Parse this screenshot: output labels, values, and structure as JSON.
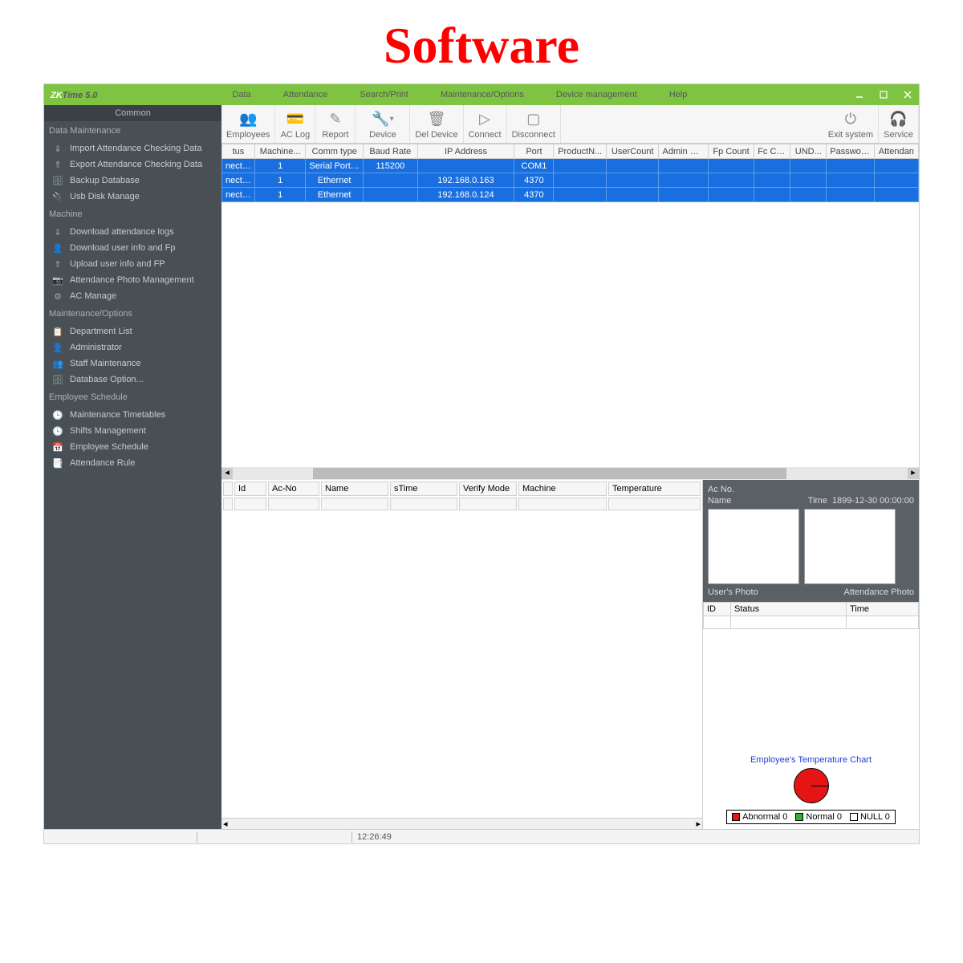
{
  "page_heading": "Software",
  "app": {
    "title_green": "ZK",
    "title_gray": "Time 5.0"
  },
  "menu": [
    "Data",
    "Attendance",
    "Search/Print",
    "Maintenance/Options",
    "Device management",
    "Help"
  ],
  "toolbar": {
    "items": [
      {
        "label": "Employees"
      },
      {
        "label": "AC Log"
      },
      {
        "label": "Report"
      },
      {
        "label": "Device"
      },
      {
        "label": "Del Device"
      },
      {
        "label": "Connect"
      },
      {
        "label": "Disconnect"
      }
    ],
    "right": [
      {
        "label": "Exit system"
      },
      {
        "label": "Service"
      }
    ]
  },
  "sidebar": {
    "header": "Common",
    "sections": [
      {
        "title": "Data Maintenance",
        "items": [
          "Import Attendance Checking Data",
          "Export Attendance Checking Data",
          "Backup Database",
          "Usb Disk Manage"
        ]
      },
      {
        "title": "Machine",
        "items": [
          "Download attendance logs",
          "Download user info and Fp",
          "Upload user info and FP",
          "Attendance Photo Management",
          "AC Manage"
        ]
      },
      {
        "title": "Maintenance/Options",
        "items": [
          "Department List",
          "Administrator",
          "Staff Maintenance",
          "Database Option..."
        ]
      },
      {
        "title": "Employee Schedule",
        "items": [
          "Maintenance Timetables",
          "Shifts Management",
          "Employee Schedule",
          "Attendance Rule"
        ]
      }
    ]
  },
  "device_grid": {
    "columns": [
      "tus",
      "Machine...",
      "Comm type",
      "Baud Rate",
      "IP Address",
      "Port",
      "ProductN...",
      "UserCount",
      "Admin Co...",
      "Fp Count",
      "Fc Co...",
      "UND...",
      "Password...",
      "Attendan"
    ],
    "rows": [
      {
        "c": [
          "nected",
          "1",
          "Serial Port/...",
          "115200",
          "",
          "COM1",
          "",
          "",
          "",
          "",
          "",
          "",
          "",
          ""
        ]
      },
      {
        "c": [
          "nected",
          "1",
          "Ethernet",
          "",
          "192.168.0.163",
          "4370",
          "",
          "",
          "",
          "",
          "",
          "",
          "",
          ""
        ]
      },
      {
        "c": [
          "nected",
          "1",
          "Ethernet",
          "",
          "192.168.0.124",
          "4370",
          "",
          "",
          "",
          "",
          "",
          "",
          "",
          ""
        ]
      }
    ]
  },
  "log_grid": {
    "columns": [
      "Id",
      "Ac-No",
      "Name",
      "sTime",
      "Verify Mode",
      "Machine",
      "Temperature"
    ]
  },
  "info_panel": {
    "acno_label": "Ac No.",
    "name_label": "Name",
    "time_label": "Time",
    "time_value": "1899-12-30 00:00:00",
    "user_photo": "User's Photo",
    "att_photo": "Attendance Photo"
  },
  "status_grid": {
    "columns": [
      "ID",
      "Status",
      "Time"
    ]
  },
  "chart": {
    "title": "Employee's Temperature Chart",
    "legend": [
      {
        "label": "Abnormal 0",
        "color": "#e51515"
      },
      {
        "label": "Normal 0",
        "color": "#2db02d"
      },
      {
        "label": "NULL 0",
        "color": "#ffffff"
      }
    ]
  },
  "statusbar": {
    "time": "12:26:49"
  },
  "chart_data": {
    "type": "pie",
    "title": "Employee's Temperature Chart",
    "categories": [
      "Abnormal",
      "Normal",
      "NULL"
    ],
    "values": [
      0,
      0,
      0
    ]
  }
}
